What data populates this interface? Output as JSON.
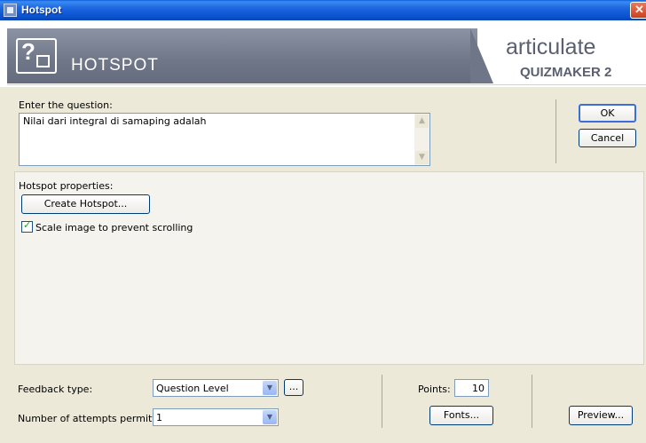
{
  "window": {
    "title": "Hotspot",
    "close_glyph": "✕"
  },
  "header": {
    "heading": "HOTSPOT",
    "brand_line1": "articulate",
    "brand_line2": "QUIZMAKER 2",
    "icon": "hotspot-question-icon"
  },
  "question": {
    "label": "Enter the question:",
    "value": "Nilai dari integral di samaping adalah"
  },
  "dialog_buttons": {
    "ok": "OK",
    "cancel": "Cancel"
  },
  "hotspot": {
    "label": "Hotspot properties:",
    "create_button": "Create Hotspot...",
    "scale_checkbox_label": "Scale image to prevent scrolling",
    "scale_checked": true
  },
  "footer": {
    "feedback_label": "Feedback type:",
    "feedback_value": "Question Level",
    "feedback_more": "...",
    "attempts_label": "Number of attempts permitted:",
    "attempts_value": "1",
    "points_label": "Points:",
    "points_value": "10",
    "fonts_button": "Fonts...",
    "preview_button": "Preview..."
  }
}
